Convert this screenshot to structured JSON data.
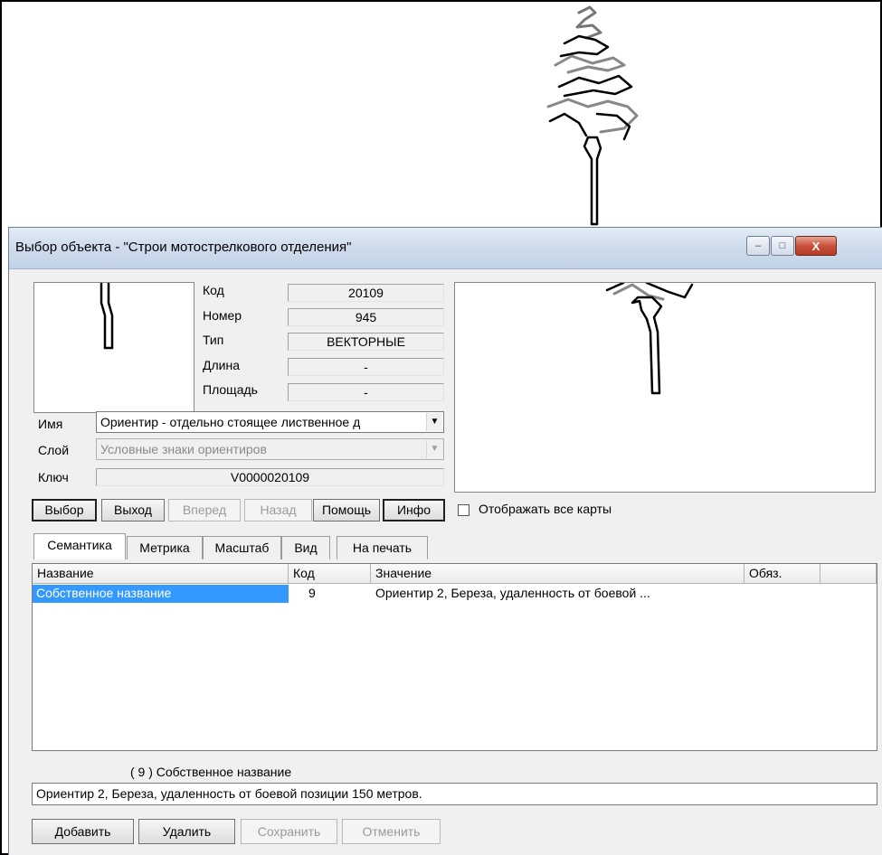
{
  "window": {
    "title": "Выбор объекта - \"Строи мотострелкового отделения\"",
    "controls": {
      "minimize": "–",
      "maximize": "□",
      "close": "X"
    }
  },
  "properties": {
    "code_label": "Код",
    "code_value": "20109",
    "number_label": "Номер",
    "number_value": "945",
    "type_label": "Тип",
    "type_value": "ВЕКТОРНЫЕ",
    "length_label": "Длина",
    "length_value": "-",
    "area_label": "Площадь",
    "area_value": "-"
  },
  "name_row": {
    "label": "Имя",
    "value": "Ориентир - отдельно стоящее лиственное д"
  },
  "layer_row": {
    "label": "Слой",
    "value": "Условные знаки ориентиров"
  },
  "key_row": {
    "label": "Ключ",
    "value": "V0000020109"
  },
  "toolbar": {
    "select": "Выбор",
    "exit": "Выход",
    "forward": "Вперед",
    "back": "Назад",
    "help": "Помощь",
    "info": "Инфо"
  },
  "show_all_maps": {
    "label": "Отображать все карты",
    "checked": false
  },
  "tabs": [
    {
      "label": "Семантика",
      "active": true
    },
    {
      "label": "Метрика",
      "active": false
    },
    {
      "label": "Масштаб",
      "active": false
    },
    {
      "label": "Вид",
      "active": false
    },
    {
      "label": "На печать",
      "active": false
    }
  ],
  "table": {
    "columns": [
      "Название",
      "Код",
      "Значение",
      "Обяз."
    ],
    "rows": [
      {
        "name": "Собственное название",
        "code": "9",
        "value": "Ориентир 2, Береза, удаленность от боевой ...",
        "required": "",
        "selected": true
      }
    ]
  },
  "detail": {
    "caption": "( 9 ) Собственное название",
    "value": "Ориентир 2, Береза, удаленность от боевой позиции 150 метров."
  },
  "bottom_buttons": {
    "add": "Добавить",
    "delete": "Удалить",
    "save": "Сохранить",
    "cancel": "Отменить"
  },
  "colors": {
    "selection": "#3399ff",
    "titlebar": "#cfdcec",
    "close_button": "#c8513c"
  }
}
